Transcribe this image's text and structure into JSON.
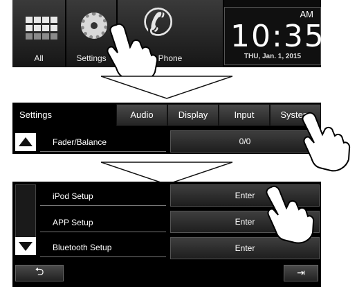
{
  "home": {
    "tiles": [
      {
        "label": "All",
        "icon": "apps-grid-icon"
      },
      {
        "label": "Settings",
        "icon": "gear-icon"
      },
      {
        "label": "Phone",
        "icon": "phone-icon"
      }
    ],
    "clock": {
      "ampm": "AM",
      "time": "10:35",
      "date": "THU, Jan. 1, 2015"
    }
  },
  "settings": {
    "title": "Settings",
    "tabs": [
      "Audio",
      "Display",
      "Input",
      "System"
    ],
    "row": {
      "label": "Fader/Balance",
      "value": "0/0"
    },
    "up_icon": "up-triangle-icon"
  },
  "list": {
    "rows": [
      {
        "label": "iPod Setup",
        "value": "Enter"
      },
      {
        "label": "APP Setup",
        "value": "Enter"
      },
      {
        "label": "Bluetooth Setup",
        "value": "Enter"
      }
    ],
    "back_glyph": "⮌",
    "exit_glyph": "⇥",
    "down_icon": "down-triangle-icon"
  },
  "colors": {
    "panel": "#000000",
    "button_top": "#3e3e3e",
    "button_bottom": "#1e1e1e",
    "text": "#ffffff"
  }
}
